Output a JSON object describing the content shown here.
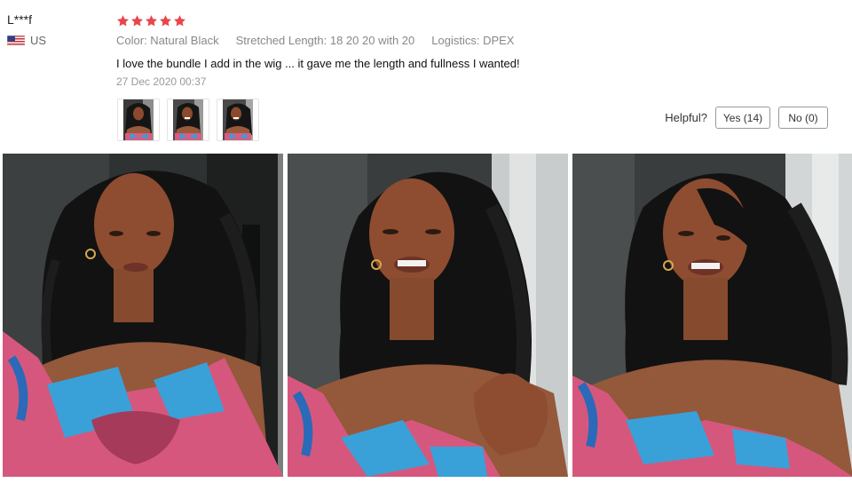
{
  "reviewer": {
    "name": "L***f",
    "country": "US",
    "flag_icon": "us-flag-icon"
  },
  "review": {
    "rating": 5,
    "max_rating": 5,
    "star_color": "#e8464b",
    "color_label": "Color: Natural Black",
    "length_label": "Stretched Length: 18 20 20 with 20",
    "logistics_label": "Logistics: DPEX",
    "text": "I love the bundle I add in the wig ... it gave me the length and fullness I wanted!",
    "date": "27 Dec 2020 00:37"
  },
  "helpful": {
    "label": "Helpful?",
    "yes_label": "Yes (14)",
    "no_label": "No (0)"
  },
  "thumbnails": [
    "review-photo-1",
    "review-photo-2",
    "review-photo-3"
  ],
  "photos": [
    "review-photo-1",
    "review-photo-2",
    "review-photo-3"
  ]
}
